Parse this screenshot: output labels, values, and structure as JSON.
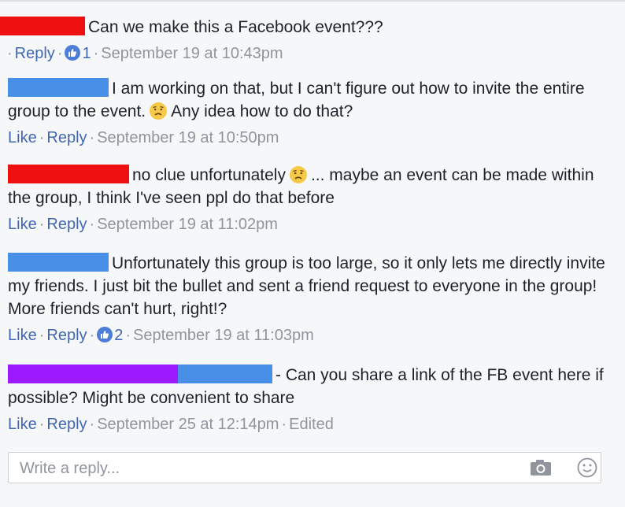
{
  "comments": [
    {
      "text_a": "Can we make this a Facebook event???",
      "text_b": "",
      "actions": {
        "reply": "Reply"
      },
      "reactions": "1",
      "timestamp": "September 19 at 10:43pm"
    },
    {
      "text_a": "I am working on that, but I can't figure out how to invite the entire group to the event.",
      "text_b": "Any idea how to do that?",
      "actions": {
        "like": "Like",
        "reply": "Reply"
      },
      "timestamp": "September 19 at 10:50pm"
    },
    {
      "text_a": "no clue unfortunately",
      "text_b": "... maybe an event can be made within the group, I think I've seen ppl do that before",
      "actions": {
        "like": "Like",
        "reply": "Reply"
      },
      "timestamp": "September 19 at 11:02pm"
    },
    {
      "text_a": "Unfortunately this group is too large, so it only lets me directly invite my friends. I just bit the bullet and sent a friend request to everyone in the group! More friends can't hurt, right!?",
      "text_b": "",
      "actions": {
        "like": "Like",
        "reply": "Reply"
      },
      "reactions": "2",
      "timestamp": "September 19 at 11:03pm"
    },
    {
      "text_a": "- Can you share a link of the FB event here if possible? Might be convenient to share",
      "text_b": "",
      "actions": {
        "like": "Like",
        "reply": "Reply"
      },
      "timestamp": "September 25 at 12:14pm",
      "edited": "Edited"
    }
  ],
  "reply_box": {
    "placeholder": "Write a reply..."
  },
  "icons": {
    "reaction": "like-reaction-icon",
    "sad": "sad-emoji-icon",
    "camera": "camera-icon",
    "sticker": "smiley-sticker-icon"
  },
  "colors": {
    "link": "#4267b2",
    "meta": "#90949c",
    "like_badge": "#4c7dd8",
    "redact_red": "#ee1010",
    "redact_blue": "#4a8fe7",
    "redact_purple": "#9d19ff"
  }
}
